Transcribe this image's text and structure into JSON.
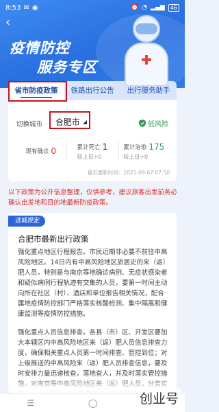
{
  "status": {
    "time": "8:53",
    "battery": "46"
  },
  "hero": {
    "title_line1": "疫情防控",
    "title_line2": "服务专区"
  },
  "tabs": [
    "省市防疫政策",
    "铁路出行公告",
    "出行服务助手"
  ],
  "city": {
    "label": "切换城市",
    "value": "合肥市",
    "risk": "低风险"
  },
  "stats": {
    "confirmed_label": "现有确诊",
    "confirmed_value": "0",
    "deaths_label": "累计死亡",
    "deaths_value": "1",
    "deaths_sub": "较上日+0",
    "cured_label": "累计治愈",
    "cured_value": "175",
    "cured_sub": "较上日+0"
  },
  "update_time": "最近更新时间：2021-09-07 07:50",
  "notice": "以下政策为公开信息整理，仅供参考，建议旅客出发前务必确认出发地和目的地最新防疫政策。",
  "policy": {
    "badge": "进城规定",
    "title": "合肥市最新出行政策",
    "paragraphs": [
      "强化重点地区行程报告。市民近期非必要不前往中高风险地区。14日内有中高风险地区旅居史的来（返）肥人员，特别是与南京等地确诊病例、无症状感染者和疑似病例行程轨迹有交集的人员，要第一时间主动向所在社区（村）、酒店和单位报告相关情况，配合属地疫情防控部门严格落实核酸检测、集中隔离和健康监测等疫情防控措施。",
      "强化重点人员信息排查。各县（市）区、开发区要加大本辖区内中高风险地区来（返）肥人员信息排查力度，确保相关重点人员第一时间排查、管控到位；对上级推送的中高风险来（返）肥人员排查信息，要及时安排力量迅速核查，落地查人，并及时落实管控措施，对南京等中高风险地区来（返）肥人员，分类实施48小时核酸检测、集中隔离、居家健康监测。对未按规定主动登记、隐瞒不报或拒不接受隔离、治疗，扰乱疫情防控工作的，要依法追究法律责任。"
    ]
  },
  "watermark": "创业号",
  "colors": {
    "primary": "#2b66d8",
    "risk_low": "#2f9b5c",
    "notice": "#d4302b",
    "cured": "#2f9b5c",
    "confirmed": "#d4302b"
  }
}
